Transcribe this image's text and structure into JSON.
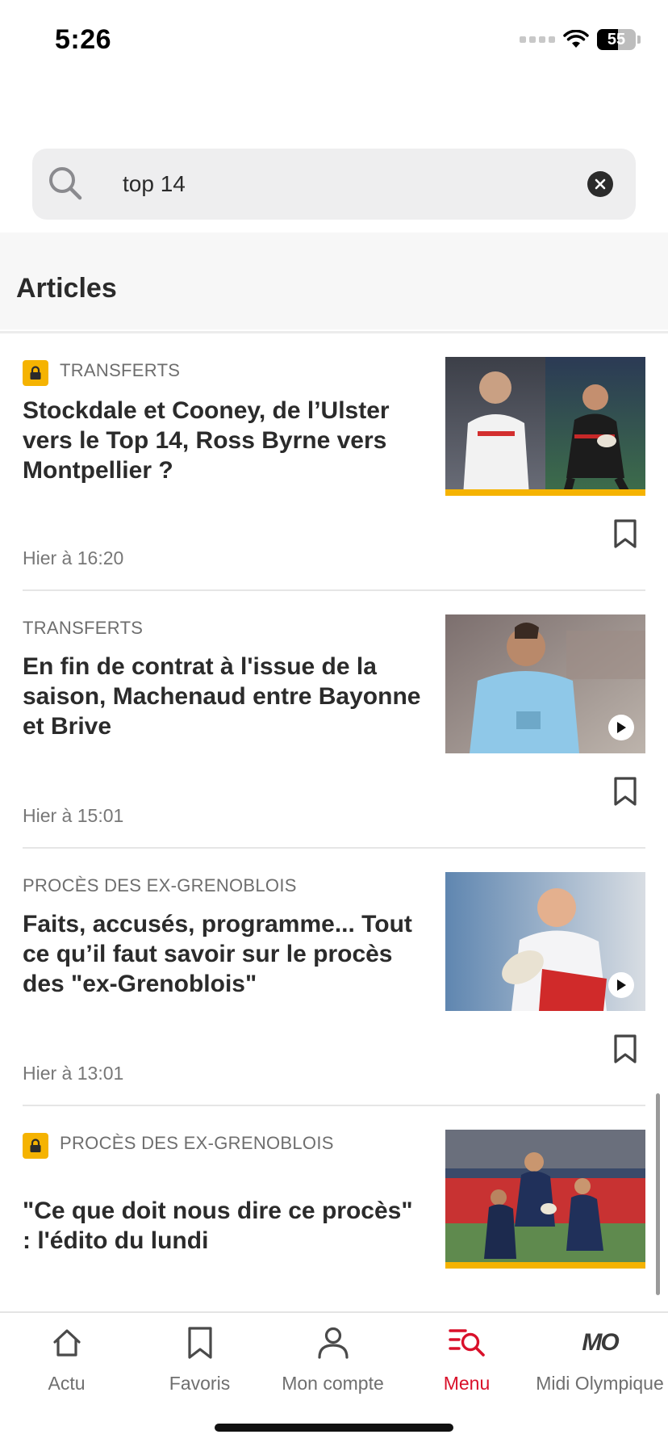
{
  "status_bar": {
    "time": "5:26",
    "battery": "55"
  },
  "search": {
    "value": "top 14",
    "placeholder": ""
  },
  "section": {
    "title": "Articles"
  },
  "articles": [
    {
      "category": "TRANSFERTS",
      "locked": true,
      "title": "Stockdale et Cooney, de l’Ulster vers le Top 14, Ross Byrne vers Montpellier ?",
      "time": "Hier à 16:20",
      "has_video": false,
      "image": "two-rugby-players-photo"
    },
    {
      "category": "TRANSFERTS",
      "locked": false,
      "title": "En fin de contrat à l'issue de la saison, Machenaud entre Bayonne et Brive",
      "time": "Hier à 15:01",
      "has_video": true,
      "image": "rugby-player-light-blue-jersey-photo"
    },
    {
      "category": "PROCÈS DES EX-GRENOBLOIS",
      "locked": false,
      "title": "Faits, accusés, programme... Tout ce qu’il faut savoir sur le procès des \"ex-Grenoblois\"",
      "time": "Hier à 13:01",
      "has_video": true,
      "image": "rugby-player-with-ball-photo"
    },
    {
      "category": "PROCÈS DES EX-GRENOBLOIS",
      "locked": true,
      "title": "\"Ce que doit nous dire ce procès\" : l'édito du lundi",
      "time": "",
      "has_video": false,
      "image": "rugby-match-action-photo"
    }
  ],
  "tab_bar": {
    "tabs": [
      {
        "label": "Actu",
        "icon": "home-icon",
        "active": false
      },
      {
        "label": "Favoris",
        "icon": "bookmark-icon",
        "active": false
      },
      {
        "label": "Mon compte",
        "icon": "user-icon",
        "active": false
      },
      {
        "label": "Menu",
        "icon": "menu-search-icon",
        "active": true
      },
      {
        "label": "Midi Olympique",
        "icon": "mo-logo",
        "logo_text": "MO",
        "active": false
      }
    ]
  },
  "colors": {
    "accent": "#d9102a",
    "premium": "#f5b301",
    "text": "#2b2b2b",
    "muted": "#6e6e6e"
  }
}
